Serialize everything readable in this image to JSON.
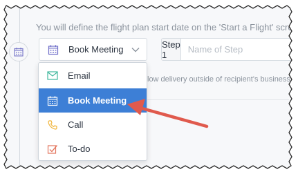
{
  "info": {
    "flight_plan_note": "You will define the flight plan start date on the 'Start a Flight' screen."
  },
  "action_select": {
    "selected_label": "Book Meeting"
  },
  "step": {
    "label": "Step 1",
    "name_placeholder": "Name of Step",
    "name_value": ""
  },
  "delivery_note": "low delivery outside of recipient's business ho",
  "menu": {
    "items": [
      {
        "label": "Email",
        "icon": "envelope-icon",
        "selected": false
      },
      {
        "label": "Book Meeting",
        "icon": "calendar-icon",
        "selected": true
      },
      {
        "label": "Call",
        "icon": "phone-icon",
        "selected": false
      },
      {
        "label": "To-do",
        "icon": "checkbox-icon",
        "selected": false
      }
    ]
  },
  "colors": {
    "selected_bg": "#3d7fd6",
    "arrow": "#e05a4d",
    "email_icon": "#3fb79d",
    "calendar_icon": "#6f6ec8",
    "phone_icon": "#f0b43a",
    "todo_icon": "#e3765e"
  }
}
